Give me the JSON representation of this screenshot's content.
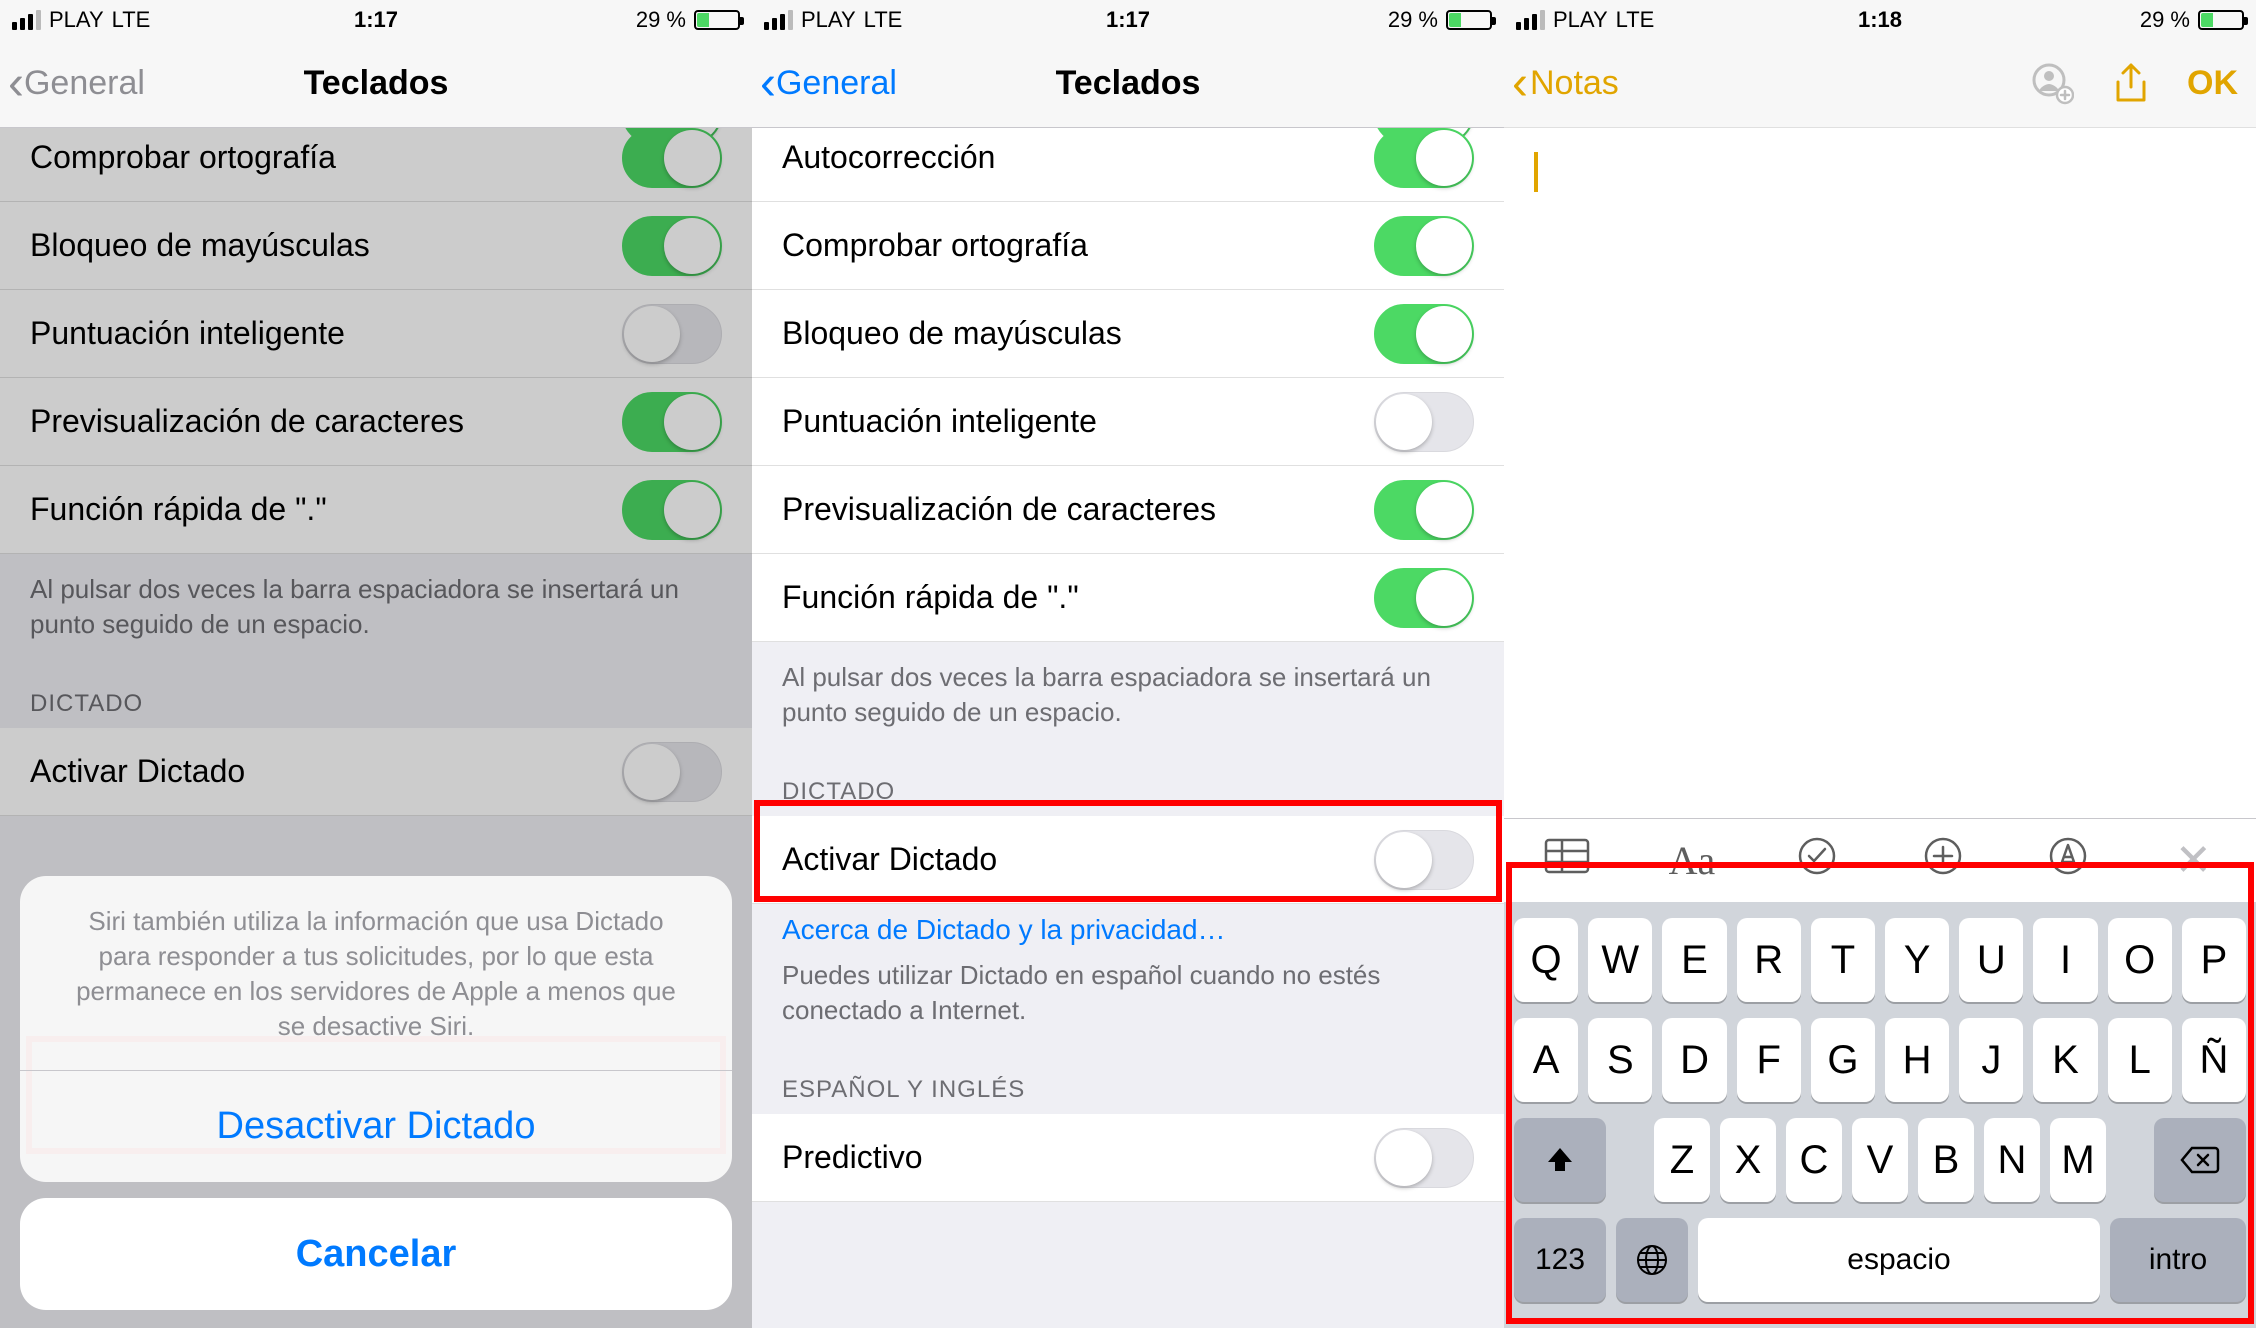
{
  "statusbar": {
    "carrier": "PLAY",
    "network": "LTE",
    "time1": "1:17",
    "time2": "1:17",
    "time3": "1:18",
    "battery_pct": "29 %"
  },
  "screen1": {
    "back": "General",
    "title": "Teclados",
    "rows": [
      {
        "label": "Comprobar ortografía",
        "on": true
      },
      {
        "label": "Bloqueo de mayúsculas",
        "on": true
      },
      {
        "label": "Puntuación inteligente",
        "on": false
      },
      {
        "label": "Previsualización de caracteres",
        "on": true
      },
      {
        "label": "Función rápida de \".\"",
        "on": true
      }
    ],
    "double_tap_note": "Al pulsar dos veces la barra espaciadora se insertará un punto seguido de un espacio.",
    "dictation_header": "DICTADO",
    "dictation_row": {
      "label": "Activar Dictado",
      "on": false
    },
    "sheet": {
      "message": "Siri también utiliza la información que usa Dictado para responder a tus solicitudes, por lo que esta permanece en los servidores de Apple a menos que se desactive Siri.",
      "destructive": "Desactivar Dictado",
      "cancel": "Cancelar"
    }
  },
  "screen2": {
    "back": "General",
    "title": "Teclados",
    "rows": [
      {
        "label": "Autocorrección",
        "on": true
      },
      {
        "label": "Comprobar ortografía",
        "on": true
      },
      {
        "label": "Bloqueo de mayúsculas",
        "on": true
      },
      {
        "label": "Puntuación inteligente",
        "on": false
      },
      {
        "label": "Previsualización de caracteres",
        "on": true
      },
      {
        "label": "Función rápida de \".\"",
        "on": true
      }
    ],
    "double_tap_note": "Al pulsar dos veces la barra espaciadora se insertará un punto seguido de un espacio.",
    "dictation_header": "DICTADO",
    "dictation_row": {
      "label": "Activar Dictado",
      "on": false
    },
    "dictation_link": "Acerca de Dictado y la privacidad…",
    "dictation_note": "Puedes utilizar Dictado en español cuando no estés conectado a Internet.",
    "lang_header": "ESPAÑOL Y INGLÉS",
    "predictive_row": {
      "label": "Predictivo",
      "on": false
    }
  },
  "screen3": {
    "back": "Notas",
    "done": "OK",
    "toolbar": {
      "aa": "Aa"
    },
    "keyboard": {
      "row1": [
        "Q",
        "W",
        "E",
        "R",
        "T",
        "Y",
        "U",
        "I",
        "O",
        "P"
      ],
      "row2": [
        "A",
        "S",
        "D",
        "F",
        "G",
        "H",
        "J",
        "K",
        "L",
        "Ñ"
      ],
      "row3": [
        "Z",
        "X",
        "C",
        "V",
        "B",
        "N",
        "M"
      ],
      "num": "123",
      "space": "espacio",
      "return": "intro"
    }
  }
}
